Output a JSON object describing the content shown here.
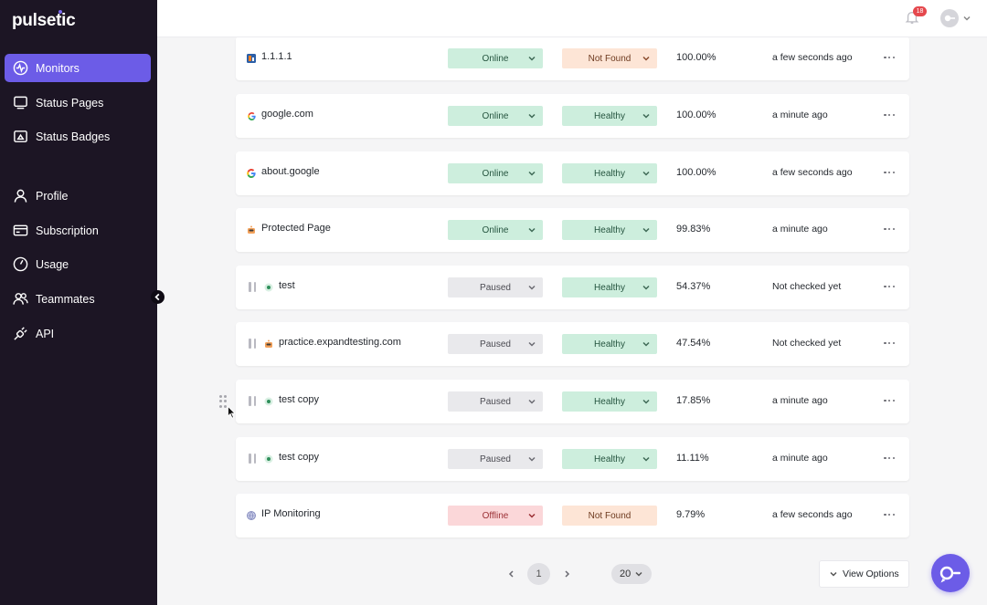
{
  "app": {
    "logo": "pulsetic",
    "brand_color": "#6c5ce7",
    "sidebar_bg": "#1c1524"
  },
  "sidebar": {
    "items": [
      {
        "label": "Monitors",
        "icon": "monitor-pulse-icon",
        "active": true
      },
      {
        "label": "Status Pages",
        "icon": "display-icon"
      },
      {
        "label": "Status Badges",
        "icon": "badge-image-icon"
      },
      {
        "label": "Profile",
        "icon": "user-icon"
      },
      {
        "label": "Subscription",
        "icon": "credit-card-icon"
      },
      {
        "label": "Usage",
        "icon": "gauge-icon"
      },
      {
        "label": "Teammates",
        "icon": "users-icon"
      },
      {
        "label": "API",
        "icon": "plug-icon"
      }
    ]
  },
  "header": {
    "notification_count": "18"
  },
  "monitors": [
    {
      "name": "1.1.1.1",
      "status": "Online",
      "health": "Not Found",
      "uptime": "100.00%",
      "last_check": "a few seconds ago",
      "paused": false,
      "favicon": "cloudflare-favicon"
    },
    {
      "name": "google.com",
      "status": "Online",
      "health": "Healthy",
      "uptime": "100.00%",
      "last_check": "a minute ago",
      "paused": false,
      "favicon": "google-favicon"
    },
    {
      "name": "about.google",
      "status": "Online",
      "health": "Healthy",
      "uptime": "100.00%",
      "last_check": "a few seconds ago",
      "paused": false,
      "favicon": "google-favicon"
    },
    {
      "name": "Protected Page",
      "status": "Online",
      "health": "Healthy",
      "uptime": "99.83%",
      "last_check": "a minute ago",
      "paused": false,
      "favicon": "robot-favicon"
    },
    {
      "name": "test",
      "status": "Paused",
      "health": "Healthy",
      "uptime": "54.37%",
      "last_check": "Not checked yet",
      "paused": true,
      "favicon": "green-dot-favicon"
    },
    {
      "name": "practice.expandtesting.com",
      "status": "Paused",
      "health": "Healthy",
      "uptime": "47.54%",
      "last_check": "Not checked yet",
      "paused": true,
      "favicon": "robot-favicon"
    },
    {
      "name": "test copy",
      "status": "Paused",
      "health": "Healthy",
      "uptime": "17.85%",
      "last_check": "a minute ago",
      "paused": true,
      "favicon": "green-dot-favicon"
    },
    {
      "name": "test copy",
      "status": "Paused",
      "health": "Healthy",
      "uptime": "11.11%",
      "last_check": "a minute ago",
      "paused": true,
      "favicon": "green-dot-favicon"
    },
    {
      "name": "IP Monitoring",
      "status": "Offline",
      "health": "Not Found",
      "uptime": "9.79%",
      "last_check": "a few seconds ago",
      "paused": false,
      "favicon": "globe-favicon"
    }
  ],
  "pagination": {
    "current_page": "1",
    "page_size": "20",
    "view_options_label": "View Options"
  }
}
